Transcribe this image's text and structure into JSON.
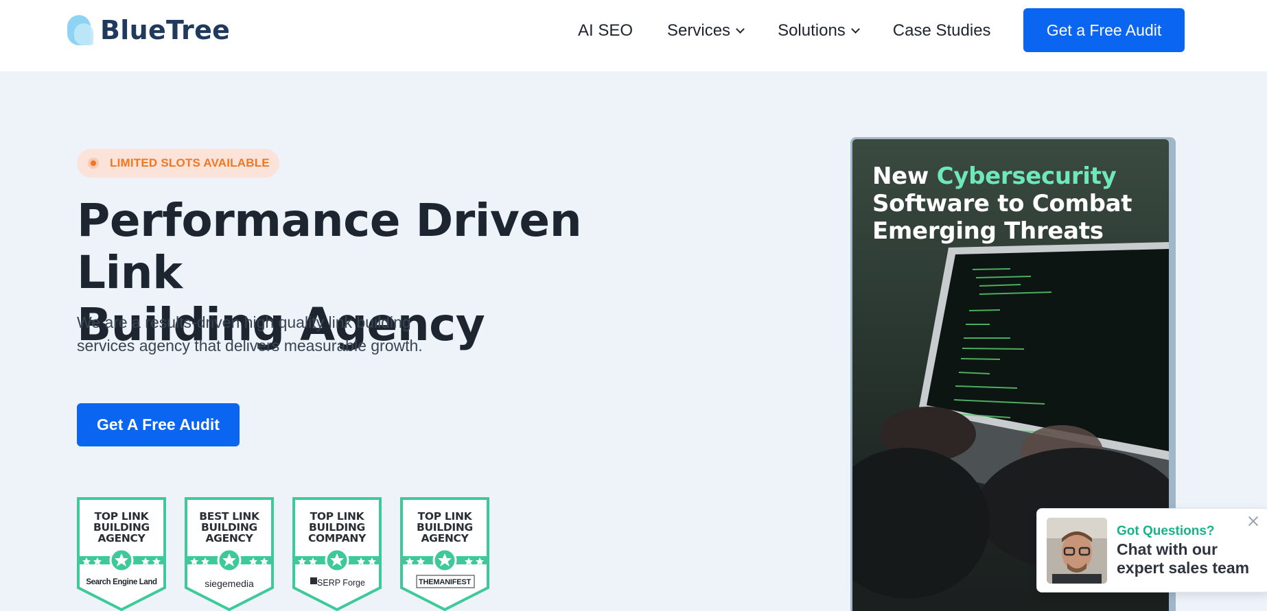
{
  "header": {
    "logo_text": "BlueTree",
    "nav": [
      {
        "label": "AI SEO",
        "has_dropdown": false
      },
      {
        "label": "Services",
        "has_dropdown": true
      },
      {
        "label": "Solutions",
        "has_dropdown": true
      },
      {
        "label": "Case Studies",
        "has_dropdown": false
      }
    ],
    "cta_label": "Get a Free Audit"
  },
  "hero": {
    "badge_text": "LIMITED SLOTS AVAILABLE",
    "title_line1": "Performance Driven Link",
    "title_line2": "Building Agency",
    "subtitle_line1": "We are a results-driven high quality link building",
    "subtitle_line2": "services agency that delivers measurable growth.",
    "cta_label": "Get A Free Audit"
  },
  "awards": [
    {
      "line1": "TOP LINK",
      "line2": "BUILDING",
      "line3": "AGENCY",
      "brand": "Search Engine Land"
    },
    {
      "line1": "BEST LINK",
      "line2": "BUILDING",
      "line3": "AGENCY",
      "brand": "siegemedia"
    },
    {
      "line1": "TOP LINK",
      "line2": "BUILDING",
      "line3": "COMPANY",
      "brand": "SERP Forge"
    },
    {
      "line1": "TOP LINK",
      "line2": "BUILDING",
      "line3": "AGENCY",
      "brand": "THEMANIFEST"
    }
  ],
  "video": {
    "title_word1": "New",
    "title_highlight": "Cybersecurity",
    "title_line2": "Software to Combat",
    "title_line3": "Emerging Threats"
  },
  "chat": {
    "question": "Got Questions?",
    "message_line1": "Chat with our",
    "message_line2": "expert sales team"
  },
  "colors": {
    "brand_blue": "#0a66f0",
    "accent_green": "#3ec99a",
    "badge_orange": "#f0761f",
    "highlight_mint": "#6ee8b8",
    "page_bg": "#eef3fa"
  }
}
